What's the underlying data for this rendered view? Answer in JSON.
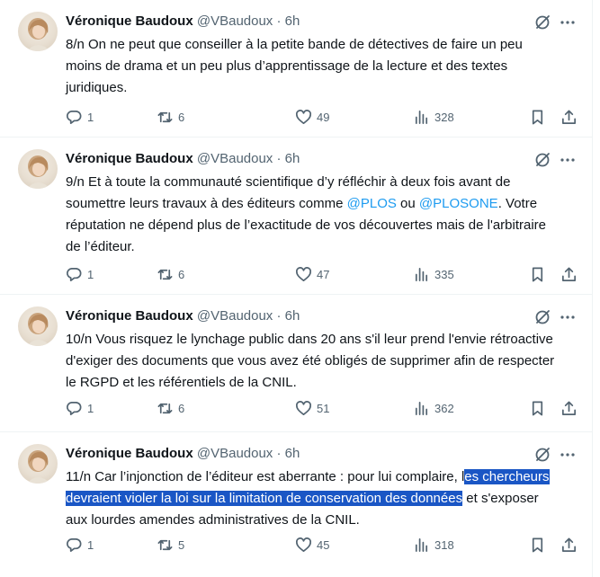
{
  "author": {
    "name": "Véronique Baudoux",
    "handle": "@VBaudoux",
    "separator": "·",
    "time": "6h"
  },
  "tweets": [
    {
      "text_before": "8/n On ne peut que conseiller à la petite bande de détectives de faire un peu moins de drama et un peu plus d’apprentissage de la lecture et des textes juridiques.",
      "replies": "1",
      "retweets": "6",
      "likes": "49",
      "views": "328"
    },
    {
      "text_before": "9/n Et à toute la communauté scientifique d’y réfléchir à deux fois avant de soumettre leurs travaux à des éditeurs comme ",
      "mention1": "@PLOS",
      "text_mid": " ou ",
      "mention2": "@PLOSONE",
      "text_after": ". Votre réputation ne dépend plus de l’exactitude de vos découvertes mais de l'arbitraire de l’éditeur.",
      "replies": "1",
      "retweets": "6",
      "likes": "47",
      "views": "335"
    },
    {
      "text_before": "10/n Vous risquez le lynchage public dans 20 ans s'il leur prend l'envie rétroactive d'exiger des documents que vous avez été obligés de supprimer afin de respecter le RGPD et les référentiels de la CNIL.",
      "replies": "1",
      "retweets": "6",
      "likes": "51",
      "views": "362"
    },
    {
      "text_before": "11/n Car l’injonction de l’éditeur est aberrante : pour lui complaire, l",
      "selected": "es chercheurs devraient violer la loi sur la limitation de conservation des données",
      "text_after": " et s'exposer aux lourdes amendes administratives de la CNIL.",
      "replies": "1",
      "retweets": "5",
      "likes": "45",
      "views": "318"
    }
  ],
  "icons": {
    "avatar": "profile-photo",
    "grok": "grok-icon",
    "more": "more-icon",
    "reply": "reply-icon",
    "retweet": "retweet-icon",
    "like": "like-icon",
    "views": "views-icon",
    "bookmark": "bookmark-icon",
    "share": "share-icon"
  },
  "colors": {
    "text": "#0f1419",
    "secondary": "#536471",
    "mention": "#1d9bf0",
    "selection": "#1a56c5",
    "divider": "#eff3f4"
  }
}
